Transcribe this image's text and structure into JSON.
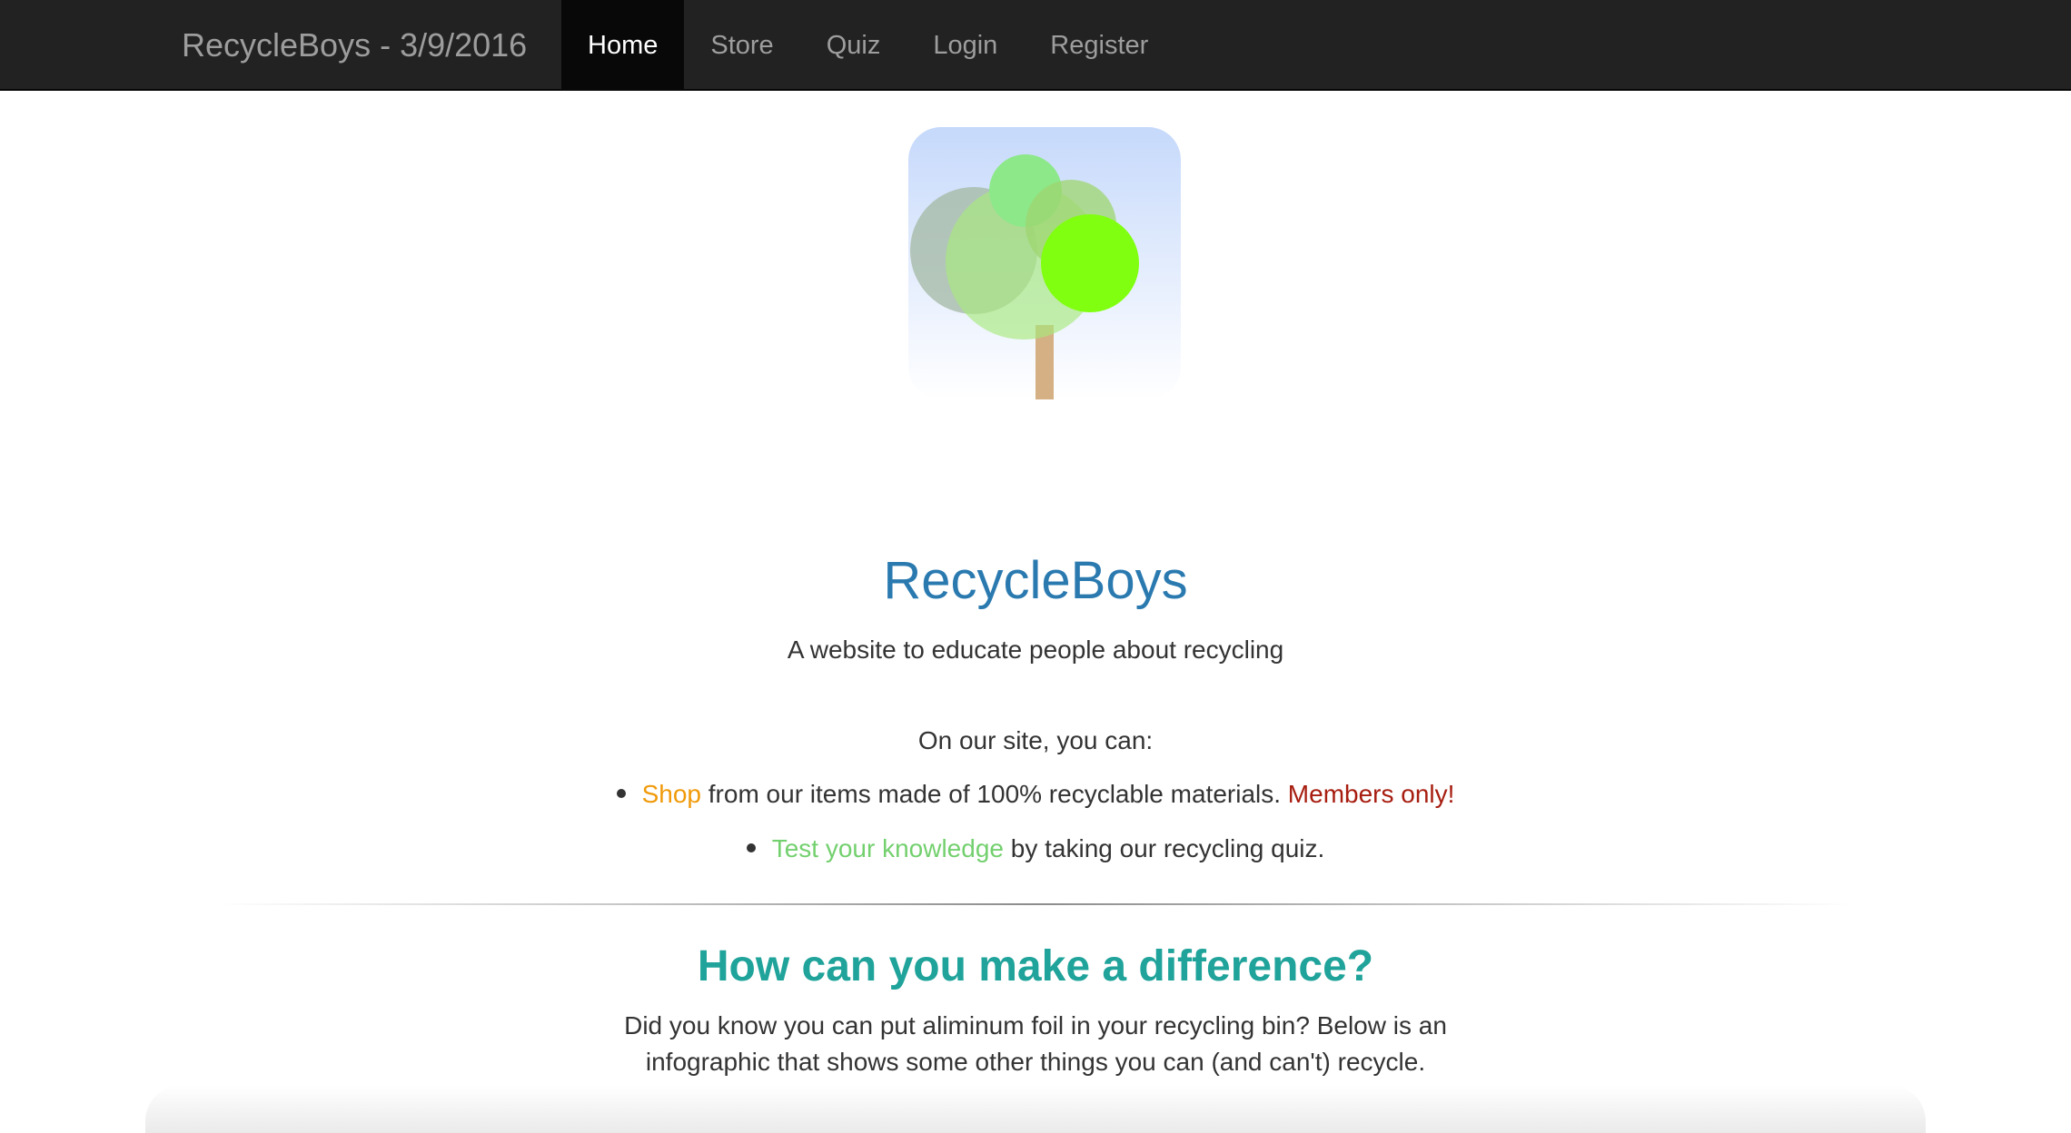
{
  "navbar": {
    "brand": "RecycleBoys - 3/9/2016",
    "items": [
      {
        "label": "Home",
        "active": true
      },
      {
        "label": "Store",
        "active": false
      },
      {
        "label": "Quiz",
        "active": false
      },
      {
        "label": "Login",
        "active": false
      },
      {
        "label": "Register",
        "active": false
      }
    ]
  },
  "hero": {
    "logo_icon": "tree-icon",
    "title": "RecycleBoys",
    "subtitle": "A website to educate people about recycling",
    "intro": "On our site, you can:",
    "features": [
      {
        "link": "Shop",
        "text": " from our items made of 100% recyclable materials. ",
        "note": "Members only!"
      },
      {
        "link": "Test your knowledge",
        "text": " by taking our recycling quiz."
      }
    ]
  },
  "section": {
    "title": "How can you make a difference?",
    "text": "Did you know you can put aliminum foil in your recycling bin? Below is an infographic that shows some other things you can (and can't) recycle."
  },
  "colors": {
    "navbar_bg": "#222222",
    "title": "#2a7ab0",
    "section_title": "#1fa39a",
    "shop_link": "#f09a0a",
    "members_only": "#a71d10",
    "quiz_link": "#73d06e"
  }
}
